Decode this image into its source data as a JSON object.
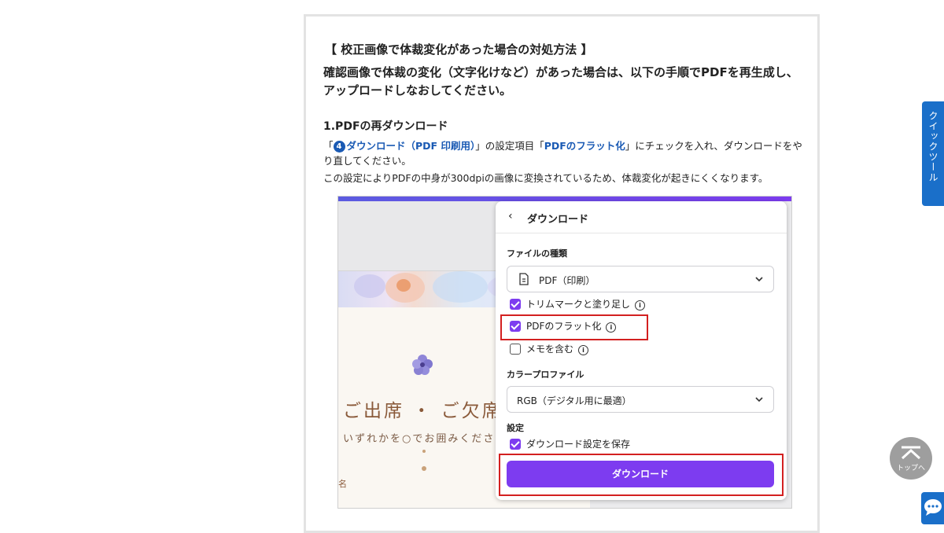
{
  "article": {
    "heading": "【 校正画像で体裁変化があった場合の対処方法 】",
    "lead": "確認画像で体裁の変化（文字化けなど）があった場合は、以下の手順でPDFを再生成し、アップロードしなおしてください。",
    "step_title": "1.PDFの再ダウンロード",
    "body_open_bracket": "「",
    "body_step_num": "4",
    "body_link1": "ダウンロード（PDF 印刷用）",
    "body_mid": "」の設定項目「",
    "body_link2": "PDFのフラット化",
    "body_rest": "」にチェックを入れ、ダウンロードをやり直してください。",
    "body2": "この設定によりPDFの中身が300dpiの画像に変換されているため、体裁変化が起きにくくなります。"
  },
  "screenshot": {
    "card": {
      "title": "ご出席 ・ ご欠席",
      "subtitle": "いずれかを○でお囲みくださ",
      "name_label": "名"
    },
    "panel": {
      "title": "ダウンロード",
      "file_type_label": "ファイルの種類",
      "file_type_value": "PDF（印刷）",
      "options": [
        {
          "label": "トリムマークと塗り足し",
          "checked": true
        },
        {
          "label": "PDFのフラット化",
          "checked": true
        },
        {
          "label": "メモを含む",
          "checked": false
        }
      ],
      "color_profile_label": "カラープロファイル",
      "color_profile_value": "RGB（デジタル用に最適）",
      "settings_label": "設定",
      "save_settings_label": "ダウンロード設定を保存",
      "save_settings_checked": true,
      "download_button": "ダウンロード",
      "accent_color": "#7d3cf0",
      "highlight_color": "#d32020"
    }
  },
  "side": {
    "quick_tool_label": "クイックツール",
    "to_top_label": "トップへ"
  },
  "colors": {
    "link": "#1a5ab4",
    "side_blue": "#1a6fc9"
  }
}
